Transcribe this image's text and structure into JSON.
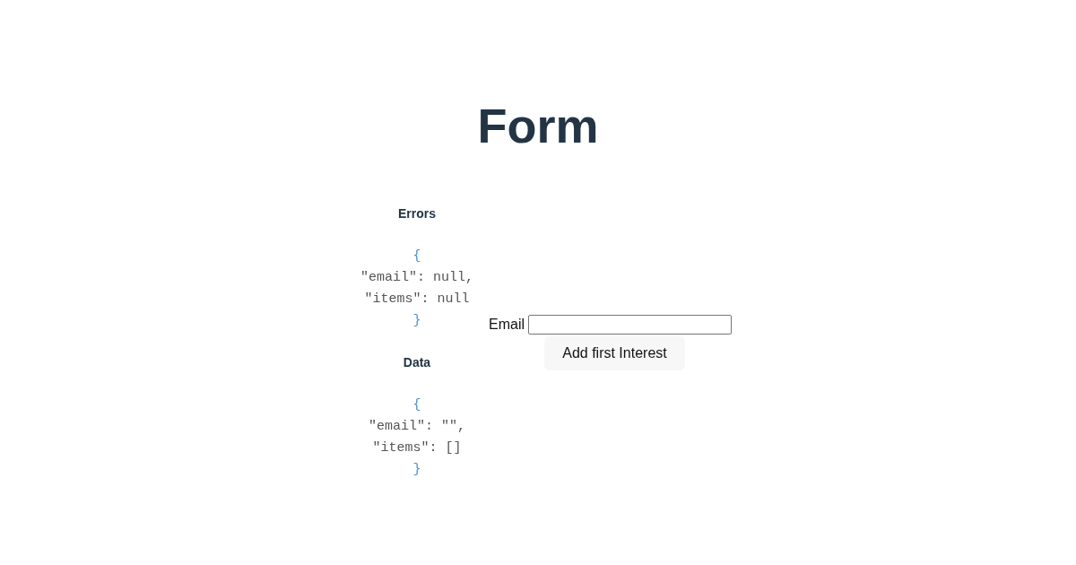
{
  "title": "Form",
  "panels": [
    {
      "heading": "Errors",
      "lines": [
        {
          "text": "{",
          "kind": "brace"
        },
        {
          "text": "\"email\": null,",
          "kind": "entry"
        },
        {
          "text": "\"items\": null",
          "kind": "entry"
        },
        {
          "text": "}",
          "kind": "brace"
        }
      ]
    },
    {
      "heading": "Data",
      "lines": [
        {
          "text": "{",
          "kind": "brace"
        },
        {
          "text": "\"email\": \"\",",
          "kind": "entry"
        },
        {
          "text": "\"items\": []",
          "kind": "entry"
        },
        {
          "text": "}",
          "kind": "brace"
        }
      ]
    }
  ],
  "form": {
    "email_label": "Email",
    "add_button": "Add first Interest"
  }
}
